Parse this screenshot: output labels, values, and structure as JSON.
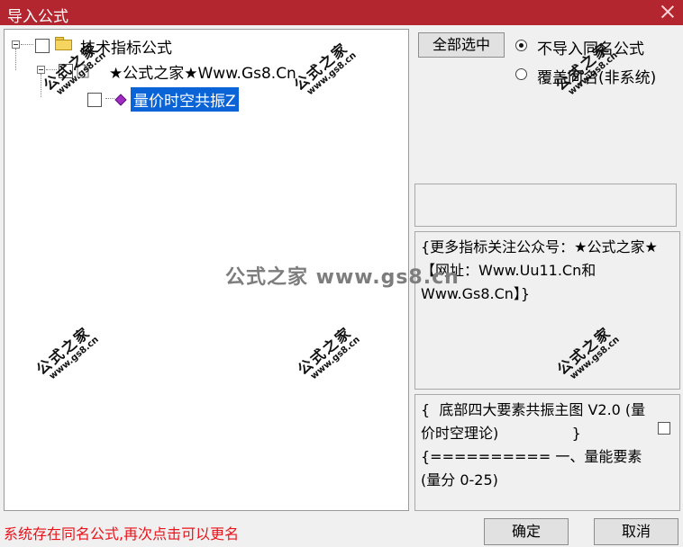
{
  "window": {
    "title": "导入公式"
  },
  "tree": {
    "root_label": "技术指标公式",
    "child_label": "★公式之家★Www.Gs8.Cn",
    "leaf_label": "量价时空共振Z"
  },
  "controls": {
    "select_all": "全部选中",
    "radio_options": [
      {
        "label": "不导入同名公式",
        "checked": true
      },
      {
        "label": "覆盖同名(非系统)",
        "checked": false
      }
    ]
  },
  "info_box": {
    "text": "{更多指标关注公众号：★公式之家★ 【网址：Www.Uu11.Cn和Www.Gs8.Cn】}"
  },
  "desc_box": {
    "text": "{  底部四大要素共振主图 V2.0 (量价时空理论)                }\n{========== 一、量能要素 (量分 0-25)"
  },
  "status_text": "系统存在同名公式,再次点击可以更名",
  "buttons": {
    "ok": "确定",
    "cancel": "取消"
  },
  "watermark": {
    "cn": "公式之家",
    "url": "www.gs8.cn",
    "center": "公式之家 www.gs8.cn"
  },
  "colors": {
    "titlebar": "#b3262f",
    "status": "#e8141b",
    "selection": "#0a64d8"
  }
}
